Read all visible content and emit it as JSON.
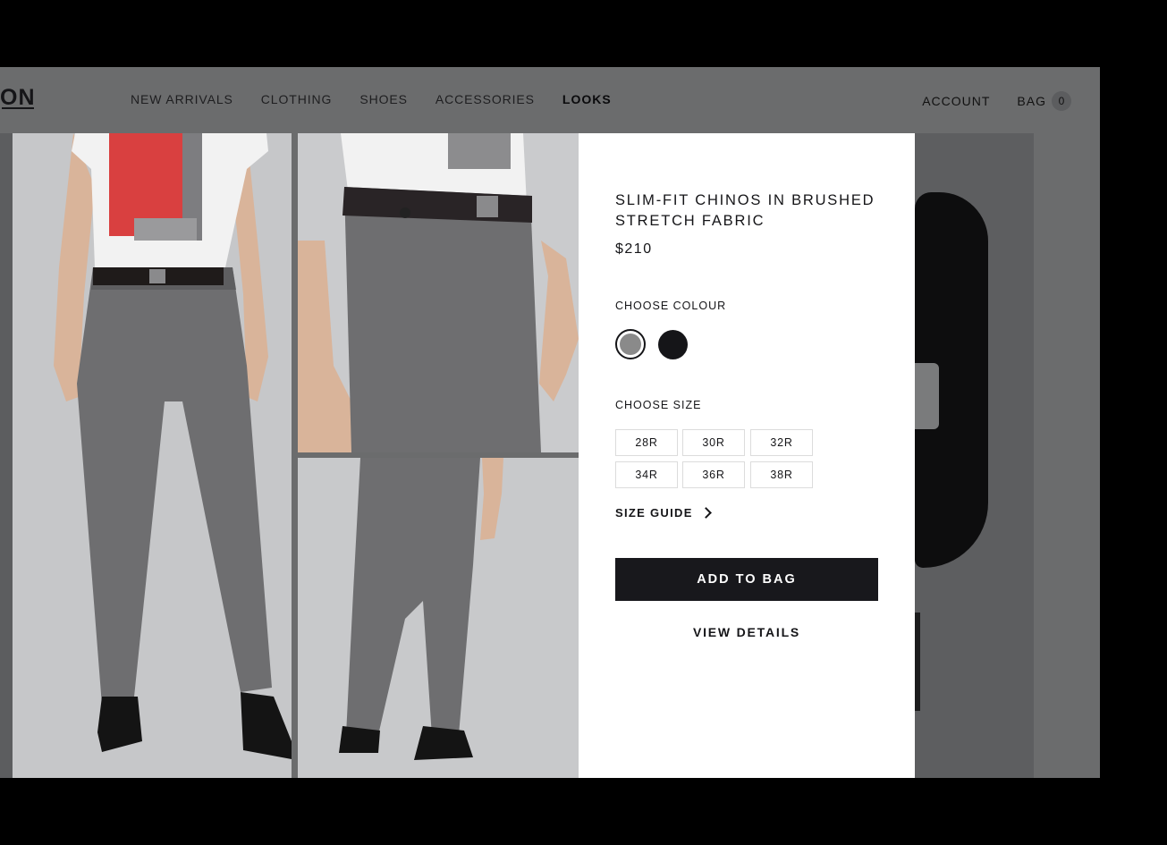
{
  "brand": {
    "logo_text": "ON"
  },
  "nav": {
    "items": [
      {
        "label": "NEW ARRIVALS"
      },
      {
        "label": "CLOTHING"
      },
      {
        "label": "SHOES"
      },
      {
        "label": "ACCESSORIES"
      },
      {
        "label": "LOOKS"
      }
    ],
    "account_label": "ACCOUNT",
    "bag_label": "BAG",
    "bag_count": "0"
  },
  "product": {
    "title": "SLIM-FIT CHINOS IN BRUSHED STRETCH FABRIC",
    "price": "$210",
    "colour_heading": "CHOOSE COLOUR",
    "colours": [
      {
        "name": "grey",
        "hex": "#8a8a8a",
        "selected": true
      },
      {
        "name": "black",
        "hex": "#151518",
        "selected": false
      }
    ],
    "size_heading": "CHOOSE SIZE",
    "sizes": [
      "28R",
      "30R",
      "32R",
      "34R",
      "36R",
      "38R"
    ],
    "size_guide_label": "SIZE GUIDE",
    "add_to_bag_label": "ADD TO BAG",
    "view_details_label": "VIEW DETAILS"
  },
  "colors": {
    "overlay": "#6b6c6d",
    "dark": "#18181c",
    "trousers": "#6e6e70",
    "shirt": "#f2f2f2",
    "print_red": "#d94040"
  }
}
